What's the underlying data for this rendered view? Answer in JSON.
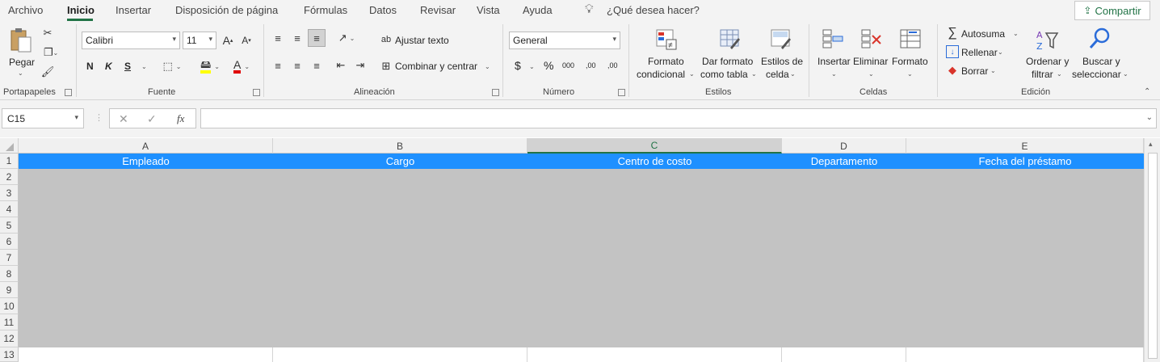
{
  "menu": {
    "items": [
      "Archivo",
      "Inicio",
      "Insertar",
      "Disposición de página",
      "Fórmulas",
      "Datos",
      "Revisar",
      "Vista",
      "Ayuda"
    ],
    "tell_me": "¿Qué desea hacer?",
    "share": "Compartir"
  },
  "ribbon": {
    "portapapeles": {
      "paste": "Pegar",
      "label": "Portapapeles"
    },
    "fuente": {
      "font_name": "Calibri",
      "font_size": "11",
      "bold": "N",
      "italic": "K",
      "underline": "S",
      "label": "Fuente"
    },
    "alineacion": {
      "wrap": "Ajustar texto",
      "merge": "Combinar y centrar",
      "label": "Alineación"
    },
    "numero": {
      "format": "General",
      "currency": "$",
      "percent": "%",
      "thousands": "000",
      "inc_dec": ",00",
      "dec_dec": ",00",
      "label": "Número"
    },
    "estilos": {
      "cond_format_1": "Formato",
      "cond_format_2": "condicional",
      "as_table_1": "Dar formato",
      "as_table_2": "como tabla",
      "cell_styles_1": "Estilos de",
      "cell_styles_2": "celda",
      "label": "Estilos"
    },
    "celdas": {
      "insert": "Insertar",
      "delete": "Eliminar",
      "format": "Formato",
      "label": "Celdas"
    },
    "edicion": {
      "autosum": "Autosuma",
      "fill": "Rellenar",
      "clear": "Borrar",
      "sort_1": "Ordenar y",
      "sort_2": "filtrar",
      "find_1": "Buscar y",
      "find_2": "seleccionar",
      "label": "Edición"
    }
  },
  "formula_bar": {
    "name_box": "C15",
    "fx": "fx",
    "value": ""
  },
  "sheet": {
    "columns": [
      "A",
      "B",
      "C",
      "D",
      "E"
    ],
    "rows": [
      "1",
      "2",
      "3",
      "4",
      "5",
      "6",
      "7",
      "8",
      "9",
      "10",
      "11",
      "12",
      "13"
    ],
    "header_row": [
      "Empleado",
      "Cargo",
      "Centro de costo",
      "Departamento",
      "Fecha del préstamo"
    ]
  },
  "colors": {
    "accent": "#217346",
    "header_fill": "#1e90ff",
    "empty_fill": "#c3c3c3"
  }
}
